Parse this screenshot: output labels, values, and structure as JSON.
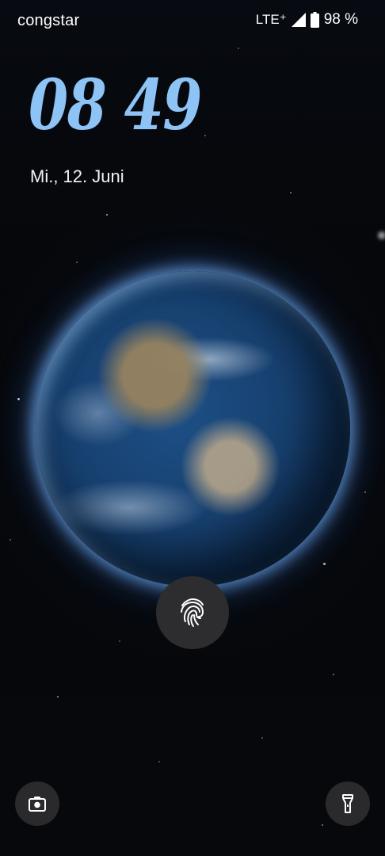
{
  "status_bar": {
    "carrier": "congstar",
    "network": "LTE⁺",
    "battery_text": "98 %",
    "signal_icon": "signal-full-icon",
    "battery_icon": "battery-high-icon"
  },
  "lock_screen": {
    "clock": "08 49",
    "date": "Mi., 12. Juni",
    "clock_color": "#8ec3f5"
  },
  "wallpaper": {
    "subject": "earth-from-space"
  },
  "shortcuts": {
    "fingerprint_icon": "fingerprint-icon",
    "left_icon": "camera-icon",
    "right_icon": "flashlight-icon"
  }
}
